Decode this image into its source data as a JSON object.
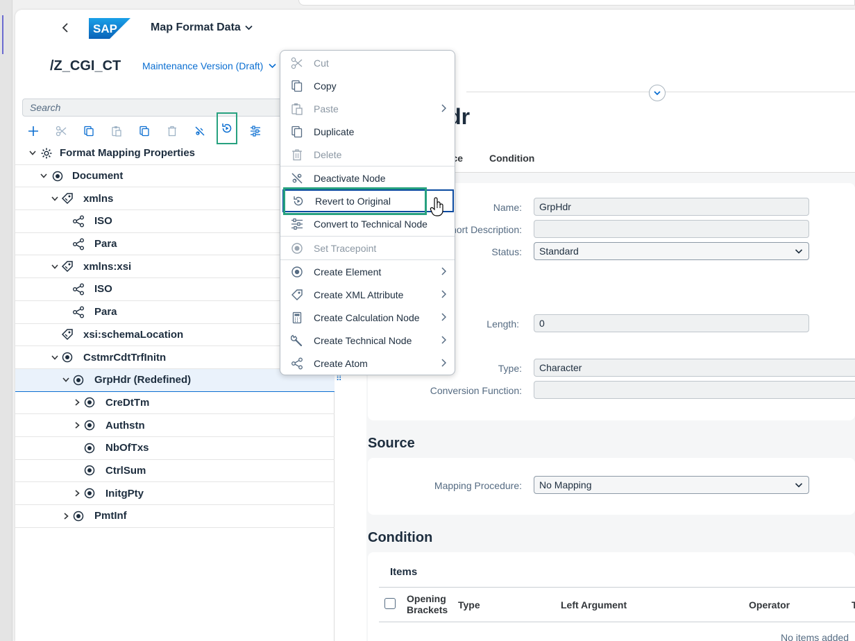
{
  "app": {
    "title": "Map Format Data",
    "object_title": "/Z_CGI_CT",
    "variant": "Maintenance Version (Draft)",
    "logo_text": "SAP"
  },
  "search": {
    "placeholder": "Search"
  },
  "toolbar": {
    "buttons": [
      "add-icon",
      "cut-icon",
      "copy-icon",
      "paste-icon",
      "duplicate-icon",
      "delete-icon",
      "deactivate-icon",
      "revert-icon",
      "technical-node-icon"
    ],
    "highlighted": "revert-icon"
  },
  "tree": {
    "rows": [
      {
        "label": "Format Mapping Properties",
        "icon": "gear-icon",
        "expanded": true
      },
      {
        "label": "Document",
        "icon": "element-icon",
        "expanded": true
      },
      {
        "label": "xmlns",
        "icon": "attribute-icon",
        "expanded": true
      },
      {
        "label": "ISO",
        "icon": "atom-icon"
      },
      {
        "label": "Para",
        "icon": "atom-icon"
      },
      {
        "label": "xmlns:xsi",
        "icon": "attribute-icon",
        "expanded": true
      },
      {
        "label": "ISO",
        "icon": "atom-icon"
      },
      {
        "label": "Para",
        "icon": "atom-icon"
      },
      {
        "label": "xsi:schemaLocation",
        "icon": "attribute-icon"
      },
      {
        "label": "CstmrCdtTrfInitn",
        "icon": "element-icon",
        "expanded": true
      },
      {
        "label": "GrpHdr (Redefined)",
        "icon": "element-icon",
        "expanded": true,
        "selected": true
      },
      {
        "label": "CreDtTm",
        "icon": "element-icon",
        "expanded": false
      },
      {
        "label": "Authstn",
        "icon": "element-icon",
        "expanded": false
      },
      {
        "label": "NbOfTxs",
        "icon": "element-icon"
      },
      {
        "label": "CtrlSum",
        "icon": "element-icon"
      },
      {
        "label": "InitgPty",
        "icon": "element-icon",
        "expanded": false
      },
      {
        "label": "PmtInf",
        "icon": "element-icon",
        "expanded": false
      }
    ]
  },
  "detail": {
    "title_visible": "Hdr",
    "tabs": [
      "rce",
      "Condition"
    ],
    "fields": {
      "name_label": "Name:",
      "name_value": "GrpHdr",
      "short_desc_label": "hort Description:",
      "short_desc_value": "",
      "status_label": "Status:",
      "status_value": "Standard",
      "length_label": "Length:",
      "length_value": "0",
      "type_label": "Type:",
      "type_value": "Character",
      "conversion_label": "Conversion Function:",
      "conversion_value": ""
    },
    "source": {
      "title": "Source",
      "mapping_label": "Mapping Procedure:",
      "mapping_value": "No Mapping"
    },
    "condition": {
      "title": "Condition",
      "items_title": "Items",
      "columns": [
        "Opening Brackets",
        "Type",
        "Left Argument",
        "Operator",
        "T"
      ],
      "empty_text": "No items added"
    }
  },
  "context_menu": {
    "items": [
      {
        "label": "Cut",
        "icon": "scissors-icon",
        "disabled": true
      },
      {
        "label": "Copy",
        "icon": "copy-icon",
        "disabled": false
      },
      {
        "label": "Paste",
        "icon": "paste-icon",
        "disabled": true,
        "submenu": true
      },
      {
        "label": "Duplicate",
        "icon": "duplicate-icon",
        "disabled": false
      },
      {
        "label": "Delete",
        "icon": "trash-icon",
        "disabled": true
      },
      {
        "label": "Deactivate Node",
        "icon": "deactivate-icon",
        "disabled": false
      },
      {
        "label": "Revert to Original",
        "icon": "revert-icon",
        "disabled": false,
        "focused": true
      },
      {
        "label": "Convert to Technical Node",
        "icon": "technical-node-icon",
        "disabled": false
      },
      {
        "label": "Set Tracepoint",
        "icon": "tracepoint-icon",
        "disabled": true
      },
      {
        "label": "Create Element",
        "icon": "element-icon",
        "disabled": false,
        "submenu": true
      },
      {
        "label": "Create XML Attribute",
        "icon": "attribute-icon",
        "disabled": false,
        "submenu": true
      },
      {
        "label": "Create Calculation Node",
        "icon": "calculator-icon",
        "disabled": false,
        "submenu": true
      },
      {
        "label": "Create Technical Node",
        "icon": "wrench-icon",
        "disabled": false,
        "submenu": true
      },
      {
        "label": "Create Atom",
        "icon": "atom-icon",
        "disabled": false,
        "submenu": true
      }
    ]
  },
  "colors": {
    "accent": "#0a6ed1",
    "highlight_box": "#27a17f",
    "focus_border": "#0a4aa0",
    "text": "#1d2d3e"
  }
}
